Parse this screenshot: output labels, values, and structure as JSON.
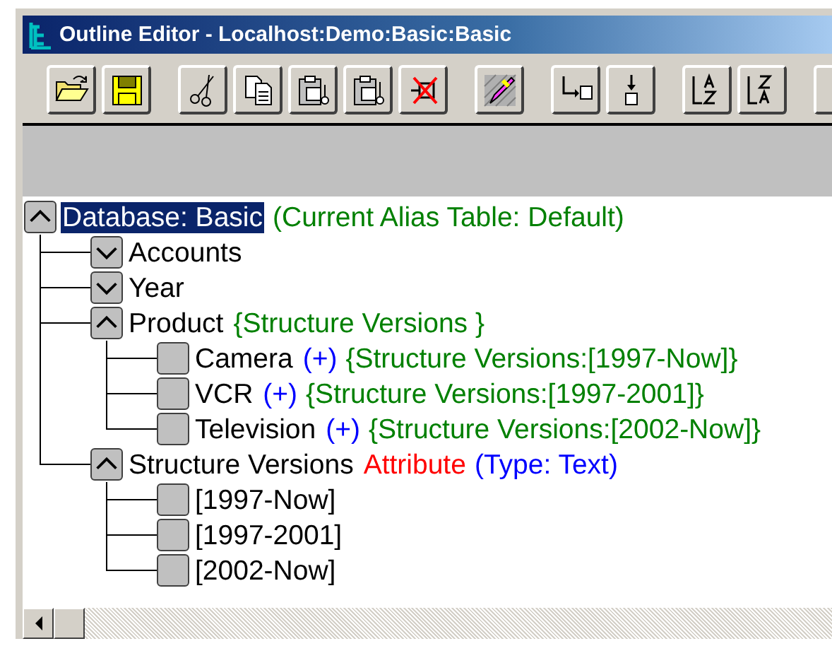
{
  "window": {
    "title": "Outline Editor - Localhost:Demo:Basic:Basic"
  },
  "outline": {
    "root": {
      "label": "Database: Basic",
      "kind": "expanded",
      "selected": true,
      "notes": [
        {
          "kind": "alias",
          "text": "(Current Alias Table: Default)"
        }
      ],
      "children": [
        {
          "label": "Accounts",
          "kind": "collapsed",
          "selected": false
        },
        {
          "label": "Year",
          "kind": "collapsed",
          "selected": false
        },
        {
          "label": "Product",
          "kind": "expanded",
          "selected": false,
          "notes": [
            {
              "kind": "structure",
              "text": "{Structure Versions }"
            }
          ],
          "children": [
            {
              "label": "Camera",
              "kind": "leaf",
              "selected": false,
              "notes": [
                {
                  "kind": "plus",
                  "text": "(+)"
                },
                {
                  "kind": "structure",
                  "text": "{Structure Versions:[1997-Now]}"
                }
              ]
            },
            {
              "label": "VCR",
              "kind": "leaf",
              "selected": false,
              "notes": [
                {
                  "kind": "plus",
                  "text": "(+)"
                },
                {
                  "kind": "structure",
                  "text": "{Structure Versions:[1997-2001]}"
                }
              ]
            },
            {
              "label": "Television",
              "kind": "leaf",
              "selected": false,
              "notes": [
                {
                  "kind": "plus",
                  "text": "(+)"
                },
                {
                  "kind": "structure",
                  "text": "{Structure Versions:[2002-Now]}"
                }
              ]
            }
          ]
        },
        {
          "label": "Structure Versions",
          "kind": "expanded",
          "selected": false,
          "notes": [
            {
              "kind": "attribute",
              "text": "Attribute"
            },
            {
              "kind": "type",
              "text": "(Type: Text)"
            }
          ],
          "children": [
            {
              "label": "[1997-Now]",
              "kind": "leaf",
              "selected": false
            },
            {
              "label": "[1997-2001]",
              "kind": "leaf",
              "selected": false
            },
            {
              "label": "[2002-Now]",
              "kind": "leaf",
              "selected": false
            }
          ]
        }
      ]
    }
  }
}
